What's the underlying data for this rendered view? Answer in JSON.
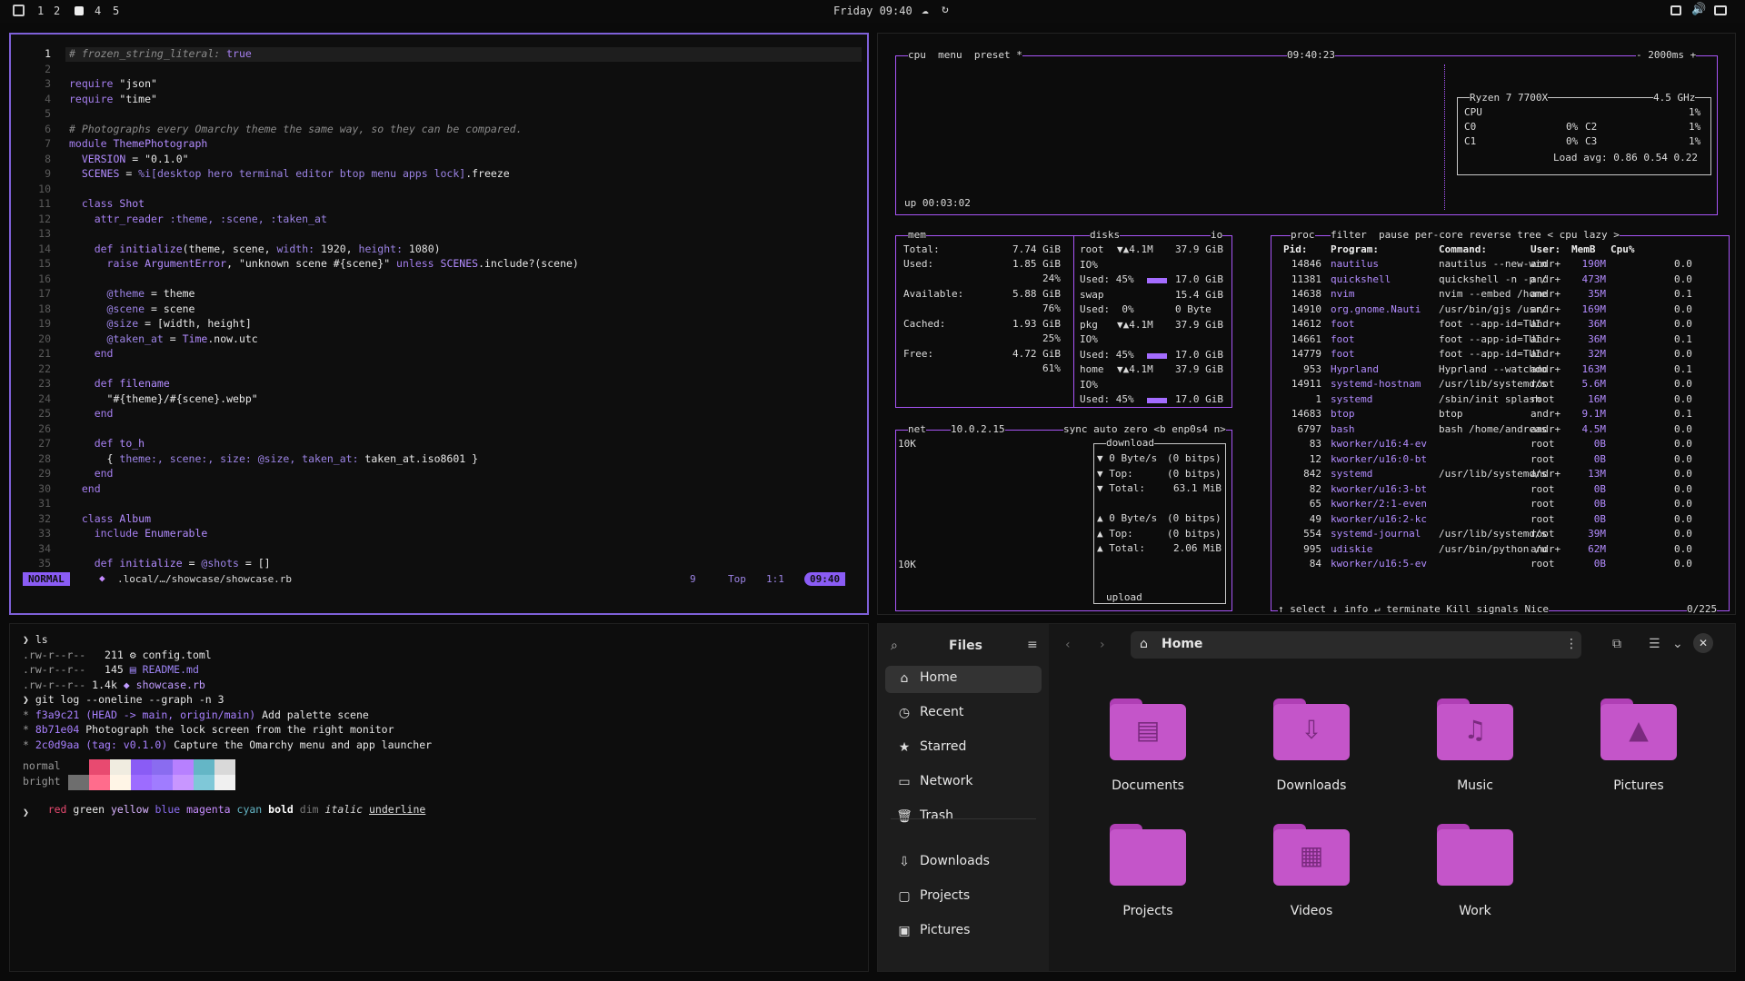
{
  "topbar": {
    "workspaces": [
      "1",
      "2",
      "4",
      "5"
    ],
    "clock": "Friday 09:40"
  },
  "editor": {
    "lines": [
      [
        "1",
        [
          [
            "cm",
            "# frozen_string_literal: "
          ],
          [
            "kw",
            "true"
          ]
        ]
      ],
      [
        "2",
        []
      ],
      [
        "3",
        [
          [
            "kw",
            "require "
          ],
          [
            "str",
            "\"json\""
          ]
        ]
      ],
      [
        "4",
        [
          [
            "kw",
            "require "
          ],
          [
            "str",
            "\"time\""
          ]
        ]
      ],
      [
        "5",
        []
      ],
      [
        "6",
        [
          [
            "cm",
            "# Photographs every Omarchy theme the same way, so they can be compared."
          ]
        ]
      ],
      [
        "7",
        [
          [
            "kw",
            "module "
          ],
          [
            "cn",
            "ThemePhotograph"
          ]
        ]
      ],
      [
        "8",
        [
          [
            "cn",
            "  VERSION"
          ],
          [
            "str",
            " = \"0.1.0\""
          ]
        ]
      ],
      [
        "9",
        [
          [
            "cn",
            "  SCENES"
          ],
          [
            "str",
            " = "
          ],
          [
            "sym",
            "%i[desktop hero terminal editor btop menu apps lock]"
          ],
          [
            "str",
            ".freeze"
          ]
        ]
      ],
      [
        "10",
        []
      ],
      [
        "11",
        [
          [
            "kw",
            "  class "
          ],
          [
            "cn",
            "Shot"
          ]
        ]
      ],
      [
        "12",
        [
          [
            "kw",
            "    attr_reader "
          ],
          [
            "sym",
            ":theme, :scene, :taken_at"
          ]
        ]
      ],
      [
        "13",
        []
      ],
      [
        "14",
        [
          [
            "kw",
            "    def "
          ],
          [
            "cn",
            "initialize"
          ],
          [
            "str",
            "(theme, scene, "
          ],
          [
            "sym",
            "width: "
          ],
          [
            "num",
            "1920"
          ],
          [
            "str",
            ", "
          ],
          [
            "sym",
            "height: "
          ],
          [
            "num",
            "1080"
          ],
          [
            "str",
            ")"
          ]
        ]
      ],
      [
        "15",
        [
          [
            "kw",
            "      raise "
          ],
          [
            "cn",
            "ArgumentError"
          ],
          [
            "str",
            ", \"unknown scene #{scene}\" "
          ],
          [
            "kw",
            "unless "
          ],
          [
            "cn",
            "SCENES"
          ],
          [
            "str",
            ".include?(scene)"
          ]
        ]
      ],
      [
        "16",
        []
      ],
      [
        "17",
        [
          [
            "sym",
            "      @theme"
          ],
          [
            "str",
            " = theme"
          ]
        ]
      ],
      [
        "18",
        [
          [
            "sym",
            "      @scene"
          ],
          [
            "str",
            " = scene"
          ]
        ]
      ],
      [
        "19",
        [
          [
            "sym",
            "      @size"
          ],
          [
            "str",
            " = [width, height]"
          ]
        ]
      ],
      [
        "20",
        [
          [
            "sym",
            "      @taken_at"
          ],
          [
            "str",
            " = "
          ],
          [
            "cn",
            "Time"
          ],
          [
            "str",
            ".now.utc"
          ]
        ]
      ],
      [
        "21",
        [
          [
            "kw",
            "    end"
          ]
        ]
      ],
      [
        "22",
        []
      ],
      [
        "23",
        [
          [
            "kw",
            "    def "
          ],
          [
            "cn",
            "filename"
          ]
        ]
      ],
      [
        "24",
        [
          [
            "str",
            "      \"#{theme}/#{scene}.webp\""
          ]
        ]
      ],
      [
        "25",
        [
          [
            "kw",
            "    end"
          ]
        ]
      ],
      [
        "26",
        []
      ],
      [
        "27",
        [
          [
            "kw",
            "    def "
          ],
          [
            "cn",
            "to_h"
          ]
        ]
      ],
      [
        "28",
        [
          [
            "str",
            "      { "
          ],
          [
            "sym",
            "theme:, scene:, size: @size, taken_at: "
          ],
          [
            "str",
            "taken_at.iso8601 }"
          ]
        ]
      ],
      [
        "29",
        [
          [
            "kw",
            "    end"
          ]
        ]
      ],
      [
        "30",
        [
          [
            "kw",
            "  end"
          ]
        ]
      ],
      [
        "31",
        []
      ],
      [
        "32",
        [
          [
            "kw",
            "  class "
          ],
          [
            "cn",
            "Album"
          ]
        ]
      ],
      [
        "33",
        [
          [
            "kw",
            "    include "
          ],
          [
            "cn",
            "Enumerable"
          ]
        ]
      ],
      [
        "34",
        []
      ],
      [
        "35",
        [
          [
            "kw",
            "    def "
          ],
          [
            "cn",
            "initialize"
          ],
          [
            "str",
            " = "
          ],
          [
            "sym",
            "@shots"
          ],
          [
            "str",
            " = []"
          ]
        ]
      ]
    ],
    "status": {
      "mode": "NORMAL",
      "path": ".local/…/showcase/showcase.rb",
      "count": "9",
      "pos": "Top",
      "cursor": "1:1",
      "time": "09:40"
    }
  },
  "btop": {
    "cpu_header": "cpu  menu  preset *",
    "cpu_time": "09:40:23",
    "cpu_rate": "- 2000ms +",
    "cpu_model": "Ryzen 7 7700X",
    "cpu_freq": "4.5 GHz",
    "cpu_rows": [
      [
        "CPU",
        "1%"
      ],
      [
        "C0",
        "0%",
        "C2",
        "1%"
      ],
      [
        "C1",
        "0%",
        "C3",
        "1%"
      ]
    ],
    "load": "Load avg: 0.86 0.54 0.22",
    "uptime": "up 00:03:02",
    "mem": {
      "title": "mem",
      "total_label": "Total:",
      "total": "7.74 GiB",
      "used_label": "Used:",
      "used": "1.85 GiB",
      "used_pct": "24%",
      "avail_label": "Available:",
      "avail": "5.88 GiB",
      "avail_pct": "76%",
      "cached_label": "Cached:",
      "cached": "1.93 GiB",
      "cached_pct": "25%",
      "free_label": "Free:",
      "free": "4.72 GiB",
      "free_pct": "61%"
    },
    "disks": {
      "title": "disks",
      "io": "io",
      "rows": [
        [
          "root",
          "▼▲4.1M",
          "37.9 GiB",
          "IO%",
          "Used: 45%",
          "17.0 GiB"
        ],
        [
          "swap",
          "",
          "15.4 GiB",
          "Used:  0%",
          "",
          "0 Byte"
        ],
        [
          "pkg",
          "▼▲4.1M",
          "37.9 GiB",
          "IO%",
          "Used: 45%",
          "17.0 GiB"
        ],
        [
          "home",
          "▼▲4.1M",
          "37.9 GiB",
          "IO%",
          "Used: 45%",
          "17.0 GiB"
        ]
      ]
    },
    "net": {
      "title": "net",
      "ip": "10.0.2.15",
      "flags": "sync auto zero <b enp0s4 n>",
      "scale_top": "10K",
      "scale_bot": "10K",
      "download": "download",
      "dl": [
        [
          "▼ 0 Byte/s",
          "(0 bitps)"
        ],
        [
          "▼ Top:",
          "(0 bitps)"
        ],
        [
          "▼ Total:",
          "63.1 MiB"
        ]
      ],
      "ul": [
        [
          "▲ 0 Byte/s",
          "(0 bitps)"
        ],
        [
          "▲ Top:",
          "(0 bitps)"
        ],
        [
          "▲ Total:",
          "2.06 MiB"
        ]
      ],
      "upload": "upload"
    },
    "proc": {
      "title": "proc",
      "header_flags": "filter  pause per-core reverse tree < cpu lazy >",
      "cols": [
        "Pid:",
        "Program:",
        "Command:",
        "User:",
        "MemB",
        "Cpu%"
      ],
      "rows": [
        [
          "14846",
          "nautilus",
          "nautilus --new-win",
          "andr+",
          "190M",
          "0.0"
        ],
        [
          "11381",
          "quickshell",
          "quickshell -n -p /",
          "andr+",
          "473M",
          "0.0"
        ],
        [
          "14638",
          "nvim",
          "nvim --embed /home",
          "andr+",
          "35M",
          "0.1"
        ],
        [
          "14910",
          "org.gnome.Nauti",
          "/usr/bin/gjs /usr/",
          "andr+",
          "169M",
          "0.0"
        ],
        [
          "14612",
          "foot",
          "foot --app-id=TUI.",
          "andr+",
          "36M",
          "0.0"
        ],
        [
          "14661",
          "foot",
          "foot --app-id=TUI.",
          "andr+",
          "36M",
          "0.1"
        ],
        [
          "14779",
          "foot",
          "foot --app-id=TUI.",
          "andr+",
          "32M",
          "0.0"
        ],
        [
          "953",
          "Hyprland",
          "Hyprland --watchdo",
          "andr+",
          "163M",
          "0.1"
        ],
        [
          "14911",
          "systemd-hostnam",
          "/usr/lib/systemd/s",
          "root",
          "5.6M",
          "0.0"
        ],
        [
          "1",
          "systemd",
          "/sbin/init splash",
          "root",
          "16M",
          "0.0"
        ],
        [
          "14683",
          "btop",
          "btop",
          "andr+",
          "9.1M",
          "0.1"
        ],
        [
          "6797",
          "bash",
          "bash /home/andreas",
          "andr+",
          "4.5M",
          "0.0"
        ],
        [
          "83",
          "kworker/u16:4-ev",
          "",
          "root",
          "0B",
          "0.0"
        ],
        [
          "12",
          "kworker/u16:0-bt",
          "",
          "root",
          "0B",
          "0.0"
        ],
        [
          "842",
          "systemd",
          "/usr/lib/systemd/s",
          "andr+",
          "13M",
          "0.0"
        ],
        [
          "82",
          "kworker/u16:3-bt",
          "",
          "root",
          "0B",
          "0.0"
        ],
        [
          "65",
          "kworker/2:1-even",
          "",
          "root",
          "0B",
          "0.0"
        ],
        [
          "49",
          "kworker/u16:2-kc",
          "",
          "root",
          "0B",
          "0.0"
        ],
        [
          "554",
          "systemd-journal",
          "/usr/lib/systemd/s",
          "root",
          "39M",
          "0.0"
        ],
        [
          "995",
          "udiskie",
          "/usr/bin/python /u",
          "andr+",
          "62M",
          "0.0"
        ],
        [
          "84",
          "kworker/u16:5-ev",
          "",
          "root",
          "0B",
          "0.0"
        ]
      ],
      "footer": "↑ select ↓ info ↵ terminate Kill signals Nice",
      "count": "0/225"
    }
  },
  "terminal": {
    "lines": [
      [
        [
          "#e6e6e6",
          "❯ ls"
        ]
      ],
      [
        [
          "#9a9a9a",
          ".rw-r--r--  "
        ],
        [
          "#e6e6e6",
          " 211 "
        ],
        [
          "#e6e6e6",
          "⚙ config.toml"
        ]
      ],
      [
        [
          "#9a9a9a",
          ".rw-r--r--  "
        ],
        [
          "#e6e6e6",
          " 145 "
        ],
        [
          "#9d84f5",
          "▤ README.md"
        ]
      ],
      [
        [
          "#9a9a9a",
          ".rw-r--r-- "
        ],
        [
          "#e6e6e6",
          "1.4k "
        ],
        [
          "#c09cff",
          "◆ showcase.rb"
        ]
      ],
      [
        [
          "#e6e6e6",
          "❯ git log --oneline --graph -n 3"
        ]
      ],
      [
        [
          "#9a9a9a",
          "* "
        ],
        [
          "#a880ff",
          "f3a9c21 (HEAD -> main, origin/main)"
        ],
        [
          "#e6e6e6",
          " Add palette scene"
        ]
      ],
      [
        [
          "#9a9a9a",
          "* "
        ],
        [
          "#a880ff",
          "8b71e04"
        ],
        [
          "#e6e6e6",
          " Photograph the lock screen from the right monitor"
        ]
      ],
      [
        [
          "#9a9a9a",
          "* "
        ],
        [
          "#a880ff",
          "2c0d9aa (tag: v0.1.0)"
        ],
        [
          "#e6e6e6",
          " Capture the Omarchy menu and app launcher"
        ]
      ]
    ],
    "palette_labels": [
      "normal",
      "bright"
    ],
    "palette_normal": [
      "#0d0d0d",
      "#e84a70",
      "#f0ece0",
      "#8a5cf5",
      "#8a6cf0",
      "#b780ff",
      "#64b6c6",
      "#d9d9d9"
    ],
    "palette_bright": [
      "#6e6e6e",
      "#ff6c8c",
      "#fff5e6",
      "#9d6cff",
      "#a07cff",
      "#c896ff",
      "#7fc8d8",
      "#f0f0f0"
    ],
    "styles": [
      [
        "#e84a70",
        "red"
      ],
      [
        "#e6e6e6",
        "green"
      ],
      [
        "#d9b3ff",
        "yellow"
      ],
      [
        "#8a6cf0",
        "blue"
      ],
      [
        "#c78dff",
        "magenta"
      ],
      [
        "#64b6c6",
        "cyan"
      ]
    ],
    "bold": "bold",
    "dim": "dim",
    "italic": "italic",
    "underline": "underline",
    "prompt": "❯"
  },
  "files": {
    "title": "Files",
    "location": "Home",
    "sidebar": [
      [
        "home",
        "⌂",
        "Home"
      ],
      [
        "recent",
        "◷",
        "Recent"
      ],
      [
        "starred",
        "★",
        "Starred"
      ],
      [
        "network",
        "▭",
        "Network"
      ],
      [
        "trash",
        "🗑",
        "Trash"
      ],
      [
        "downloads",
        "⇩",
        "Downloads"
      ],
      [
        "projects",
        "▢",
        "Projects"
      ],
      [
        "pictures",
        "▣",
        "Pictures"
      ]
    ],
    "folders": [
      [
        "Documents",
        "▤"
      ],
      [
        "Downloads",
        "⇩"
      ],
      [
        "Music",
        "♫"
      ],
      [
        "Pictures",
        "▲"
      ],
      [
        "Projects",
        ""
      ],
      [
        "Videos",
        "▦"
      ],
      [
        "Work",
        ""
      ]
    ]
  }
}
